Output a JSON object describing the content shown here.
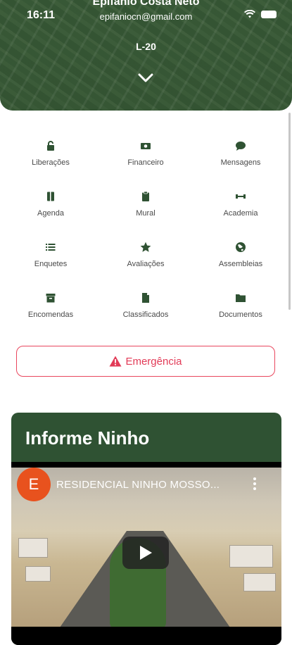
{
  "status_bar": {
    "time": "16:11"
  },
  "header": {
    "user_name": "Epifanio Costa Neto",
    "user_email": "epifaniocn@gmail.com",
    "unit": "L-20"
  },
  "menu": [
    {
      "label": "Liberações",
      "icon": "lock-icon"
    },
    {
      "label": "Financeiro",
      "icon": "money-icon"
    },
    {
      "label": "Mensagens",
      "icon": "chat-icon"
    },
    {
      "label": "Agenda",
      "icon": "book-icon"
    },
    {
      "label": "Mural",
      "icon": "clipboard-icon"
    },
    {
      "label": "Academia",
      "icon": "dumbbell-icon"
    },
    {
      "label": "Enquetes",
      "icon": "list-icon"
    },
    {
      "label": "Avaliações",
      "icon": "star-icon"
    },
    {
      "label": "Assembleias",
      "icon": "globe-icon"
    },
    {
      "label": "Encomendas",
      "icon": "package-icon"
    },
    {
      "label": "Classificados",
      "icon": "file-icon"
    },
    {
      "label": "Documentos",
      "icon": "folder-icon"
    }
  ],
  "emergency": {
    "label": "Emergência",
    "color": "#e23b57"
  },
  "news_card": {
    "title": "Informe Ninho",
    "video": {
      "channel_initial": "E",
      "title": "RESIDENCIAL NINHO MOSSO..."
    }
  },
  "colors": {
    "primary": "#2f5233",
    "icon": "#2f5233",
    "danger": "#e23b57"
  }
}
